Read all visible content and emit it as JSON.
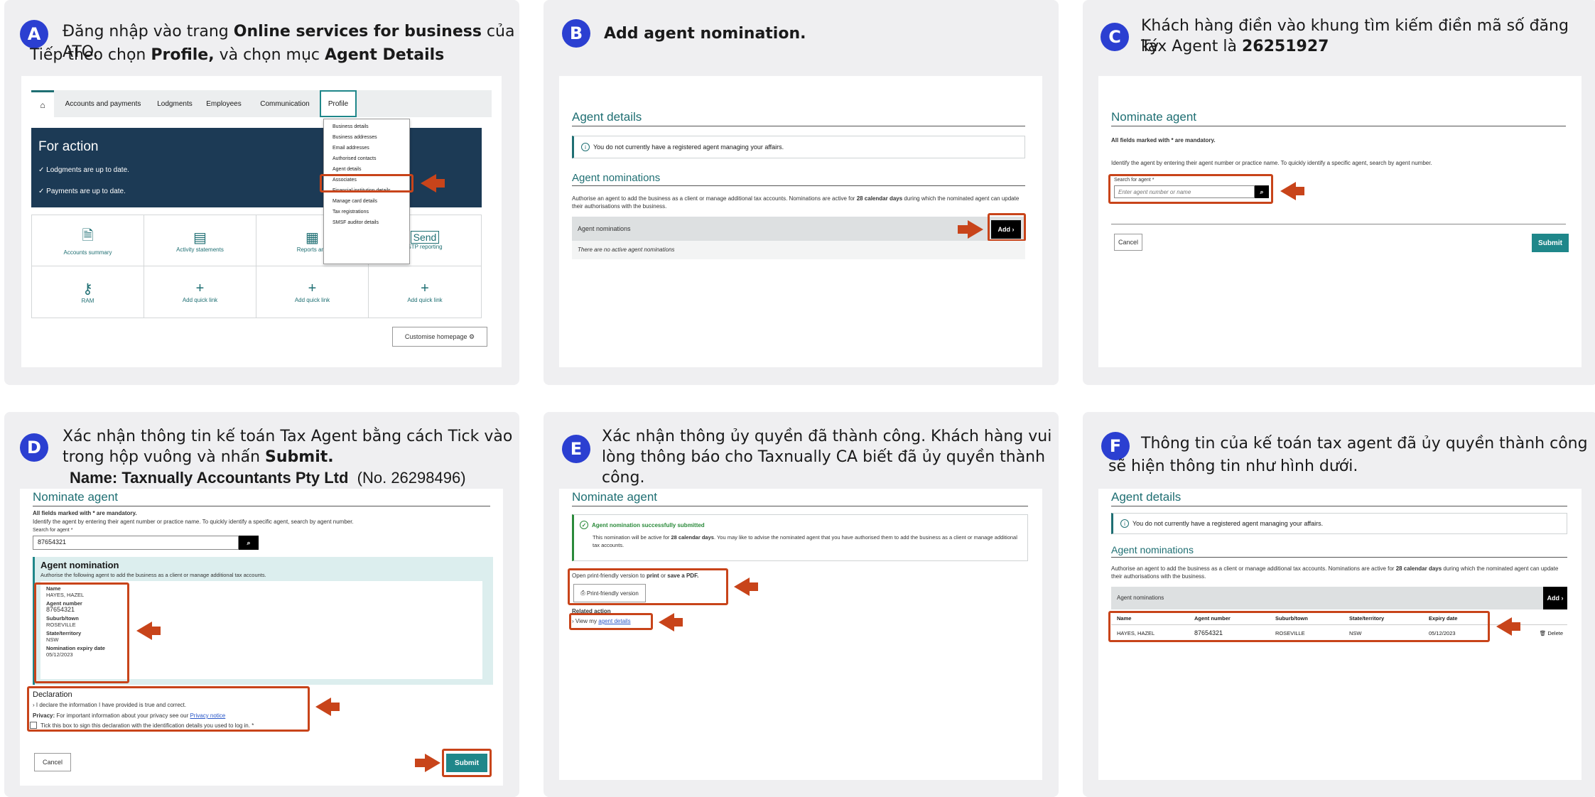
{
  "colors": {
    "badge": "#2b3fd1",
    "highlight": "#c8441a",
    "teal": "#1f6f73",
    "panel_bg": "#efeff1",
    "dark_banner": "#1c3a55"
  },
  "panels": {
    "a": {
      "badge": "A",
      "instr_1": "Đăng nhập vào trang ",
      "instr_1_bold": "Online services for business",
      "instr_1b": " của ATO.",
      "instr_2": "Tiếp theo chọn ",
      "instr_2_bold": "Profile,",
      "instr_2b": " và chọn mục ",
      "instr_2_bold2": "Agent Details",
      "nav": {
        "home_icon": "home-icon",
        "items": [
          "Accounts and payments",
          "Lodgments",
          "Employees",
          "Communication",
          "Profile"
        ]
      },
      "banner": {
        "title": "For action",
        "line1": "✓ Lodgments are up to date.",
        "line2": "✓ Payments are up to date."
      },
      "dropdown": [
        "Business details",
        "Business addresses",
        "Email addresses",
        "Authorised contacts",
        "Agent details",
        "Associates",
        "Financial institution details",
        "Manage card details",
        "Tax registrations",
        "SMSF auditor details"
      ],
      "tiles": [
        "Accounts summary",
        "Activity statements",
        "Reports and",
        "STP reporting",
        "RAM",
        "Add quick link",
        "Add quick link",
        "Add quick link"
      ],
      "customise": "Customise homepage"
    },
    "b": {
      "badge": "B",
      "instr": "Add agent nomination.",
      "title": "Agent details",
      "info": "You do not currently have a registered agent managing your affairs.",
      "nominations_title": "Agent nominations",
      "desc_1": "Authorise an agent to add the business as a client or manage additional tax accounts. Nominations are active for ",
      "desc_bold": "28 calendar days",
      "desc_2": " during which the nominated agent can update their authorisations with the business.",
      "bar_label": "Agent nominations",
      "add": "Add",
      "empty": "There are no active agent nominations"
    },
    "c": {
      "badge": "C",
      "instr_1": "Khách hàng điền vào khung tìm kiếm điền mã số đăng ký",
      "instr_2": "Tax Agent là ",
      "instr_2_bold": "26251927",
      "title": "Nominate agent",
      "mandatory": "All fields marked with * are mandatory.",
      "identify": "Identify the agent by entering their agent number or practice name. To quickly identify a specific agent, search by agent number.",
      "search_label": "Search for agent",
      "search_placeholder": "Enter agent number or name",
      "cancel": "Cancel",
      "submit": "Submit"
    },
    "d": {
      "badge": "D",
      "instr_1": "Xác nhận thông tin kế toán Tax Agent bằng cách Tick vào",
      "instr_2": "trong hộp vuông và nhấn ",
      "instr_2_bold": "Submit.",
      "name_line_bold": "Name: Taxnually Accountants Pty Ltd",
      "name_line": "(No. 26298496)",
      "title": "Nominate agent",
      "mandatory": "All fields marked with * are mandatory.",
      "identify": "Identify the agent by entering their agent number or practice name. To quickly identify a specific agent, search by agent number.",
      "search_label": "Search for agent",
      "search_value": "87654321",
      "nom_title": "Agent nomination",
      "nom_desc": "Authorise the following agent to add the business as a client or manage additional tax accounts.",
      "fields": [
        {
          "label": "Name",
          "value": "HAYES, HAZEL"
        },
        {
          "label": "Agent number",
          "value": "87654321"
        },
        {
          "label": "Suburb/town",
          "value": "ROSEVILLE"
        },
        {
          "label": "State/territory",
          "value": "NSW"
        },
        {
          "label": "Nomination expiry date",
          "value": "05/12/2023"
        }
      ],
      "decl_title": "Declaration",
      "decl_1": "I declare the information I have provided is true and correct.",
      "privacy_bold": "Privacy:",
      "privacy": " For important information about your privacy see our ",
      "privacy_link": "Privacy notice",
      "tick": "Tick this box to sign this declaration with the identification details you used to log in.",
      "cancel": "Cancel",
      "submit": "Submit"
    },
    "e": {
      "badge": "E",
      "instr_1": "Xác nhận thông ủy quyền đã thành công. Khách hàng vui",
      "instr_2": "lòng thông báo cho Taxnually CA biết đã ủy quyền thành",
      "instr_3": "công.",
      "title": "Nominate agent",
      "success_title": "Agent nomination successfully submitted",
      "success_1": "This nomination will be active for ",
      "success_bold": "28 calendar days",
      "success_2": ". You may like to advise the nominated agent that you have authorised them to add the business as a client or manage additional tax accounts.",
      "print_1": "Open print-friendly version to ",
      "print_bold1": "print",
      "print_2": " or ",
      "print_bold2": "save a PDF.",
      "print_btn": "Print-friendly version",
      "related": "Related action",
      "view": "View my ",
      "view_link": "agent details"
    },
    "f": {
      "badge": "F",
      "instr_1": "Thông tin của kế toán tax agent đã ủy quyền thành công",
      "instr_2": "sẽ hiện thông tin như hình dưới.",
      "title": "Agent details",
      "info": "You do not currently have a registered agent managing your affairs.",
      "nominations_title": "Agent nominations",
      "desc_1": "Authorise an agent to add the business as a client or manage additional tax accounts. Nominations are active for ",
      "desc_bold": "28 calendar days",
      "desc_2": " during which the nominated agent can update their authorisations with the business.",
      "bar_label": "Agent nominations",
      "add": "Add",
      "columns": [
        "Name",
        "Agent number",
        "Suburb/town",
        "State/territory",
        "Expiry date"
      ],
      "row": [
        "HAYES, HAZEL",
        "87654321",
        "ROSEVILLE",
        "NSW",
        "05/12/2023"
      ],
      "delete": "Delete"
    }
  }
}
